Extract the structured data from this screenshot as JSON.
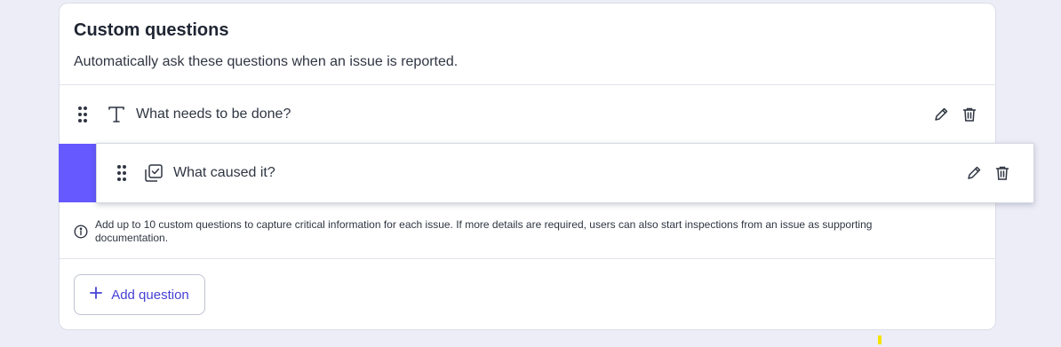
{
  "colors": {
    "accent": "#6559FF",
    "brand_text": "#4740D4",
    "marker": "#F5E400"
  },
  "section": {
    "title": "Custom questions",
    "subtitle": "Automatically ask these questions when an issue is reported."
  },
  "questions": [
    {
      "label": "What needs to be done?",
      "type_icon": "text-type-icon"
    },
    {
      "label": "What caused it?",
      "type_icon": "multiple-choice-icon",
      "state": "dragging"
    }
  ],
  "info": {
    "icon": "info-icon",
    "text": "Add up to 10 custom questions to capture critical information for each issue. If more details are required, users can also start inspections from an issue as supporting documentation."
  },
  "add_button": {
    "label": "Add question",
    "icon": "plus-icon"
  }
}
